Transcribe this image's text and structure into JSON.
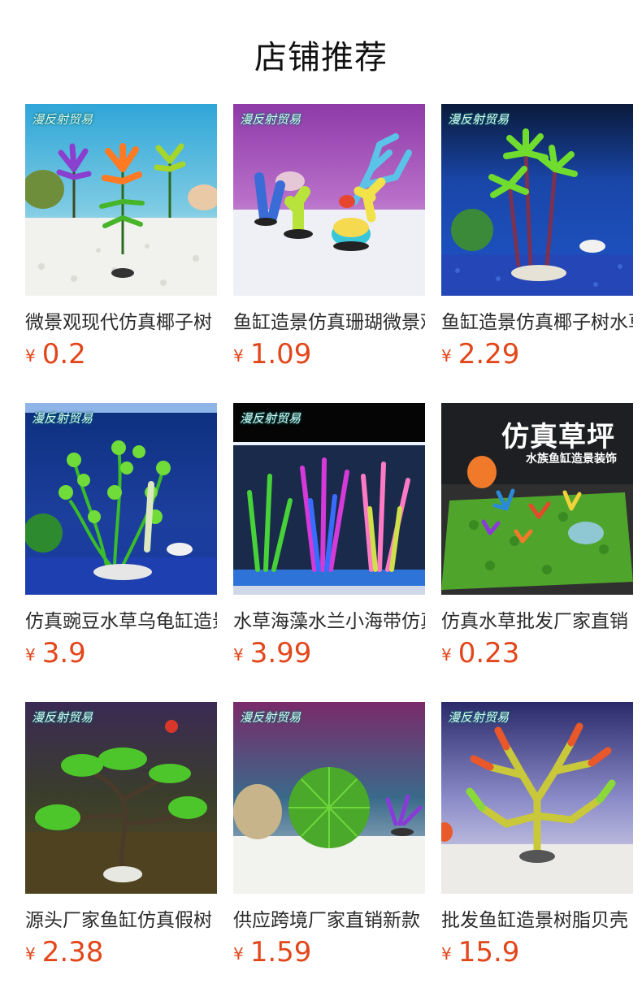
{
  "header": {
    "title": "店铺推荐"
  },
  "currency_symbol": "¥",
  "watermark": "漫反射贸易",
  "products": [
    {
      "name": "微景观现代仿真椰子树",
      "price": "0.2",
      "image": "palm-plants-white-gravel"
    },
    {
      "name": "鱼缸造景仿真珊瑚微景观",
      "price": "1.09",
      "image": "coral-miniatures"
    },
    {
      "name": "鱼缸造景仿真椰子树水草",
      "price": "2.29",
      "image": "palm-tree-blue-gravel"
    },
    {
      "name": "仿真豌豆水草乌龟缸造景",
      "price": "3.9",
      "image": "pea-water-plant"
    },
    {
      "name": "水草海藻水兰小海带仿真",
      "price": "3.99",
      "image": "seaweed-in-tank"
    },
    {
      "name": "仿真水草批发厂家直销",
      "price": "0.23",
      "image": "artificial-lawn",
      "overlay_title": "仿真草坪",
      "overlay_subtitle": "水族鱼缸造景装饰"
    },
    {
      "name": "源头厂家鱼缸仿真假树",
      "price": "2.38",
      "image": "bonsai-tree"
    },
    {
      "name": "供应跨境厂家直销新款",
      "price": "1.59",
      "image": "moss-ball"
    },
    {
      "name": "批发鱼缸造景树脂贝壳",
      "price": "15.9",
      "image": "resin-coral-tree"
    }
  ]
}
